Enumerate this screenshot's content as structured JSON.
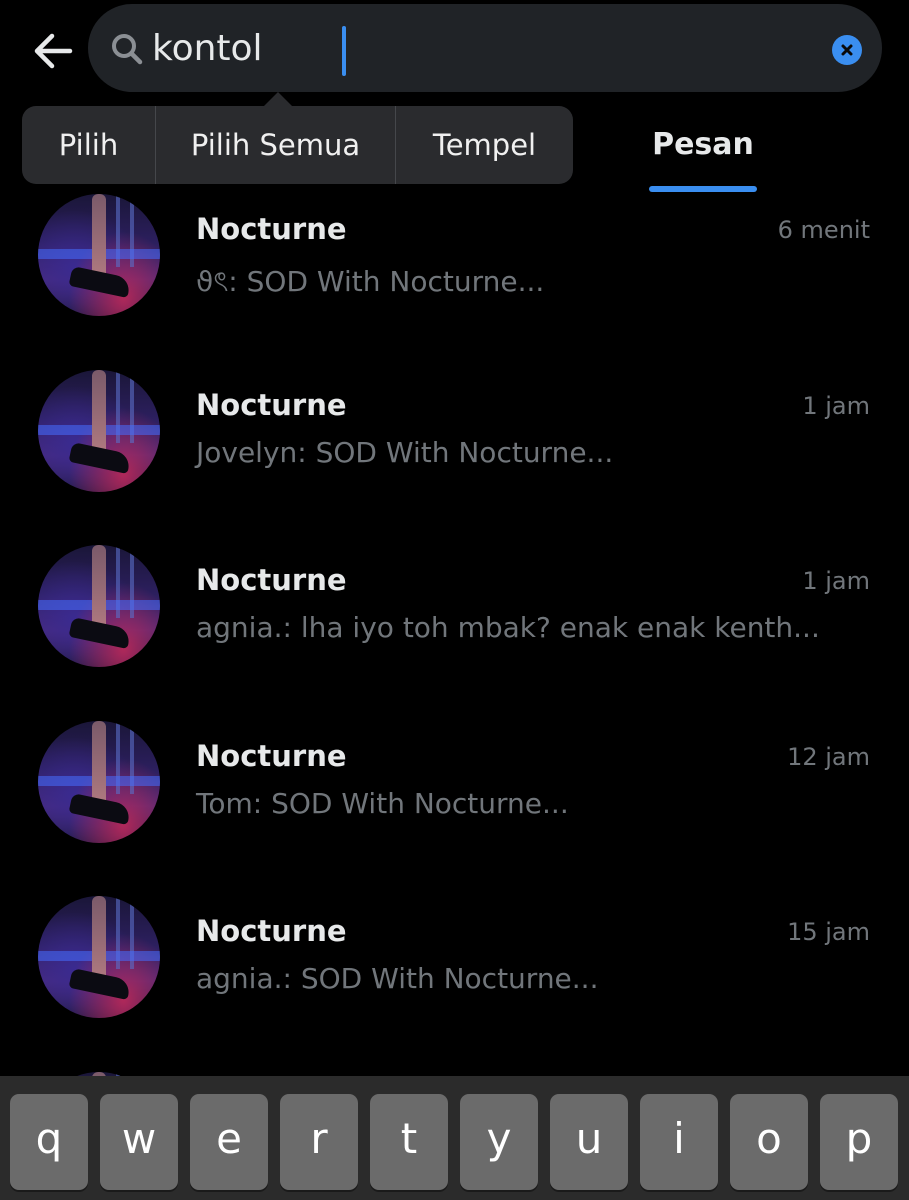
{
  "header": {
    "back_icon": "arrow-left-icon",
    "search": {
      "value": "kontol",
      "icon": "search-icon",
      "clear_icon": "close-icon"
    }
  },
  "context_menu": {
    "items": [
      "Pilih",
      "Pilih Semua",
      "Tempel"
    ]
  },
  "tabs": {
    "active": "Pesan"
  },
  "messages": [
    {
      "name": "Nocturne",
      "time": "6 menit",
      "preview": "ϑৎ: SOD With Nocturne..."
    },
    {
      "name": "Nocturne",
      "time": "1 jam",
      "preview": "Jovelyn: SOD With Nocturne..."
    },
    {
      "name": "Nocturne",
      "time": "1 jam",
      "preview": "agnia.: lha iyo toh mbak? enak enak kenth..."
    },
    {
      "name": "Nocturne",
      "time": "12 jam",
      "preview": "Tom: SOD With Nocturne..."
    },
    {
      "name": "Nocturne",
      "time": "15 jam",
      "preview": "agnia.: SOD With Nocturne..."
    }
  ],
  "keyboard": {
    "row1": [
      "q",
      "w",
      "e",
      "r",
      "t",
      "y",
      "u",
      "i",
      "o",
      "p"
    ]
  },
  "colors": {
    "accent": "#3a8ef0",
    "background": "#000000",
    "muted_text": "#71767b",
    "search_bg": "#202327"
  }
}
